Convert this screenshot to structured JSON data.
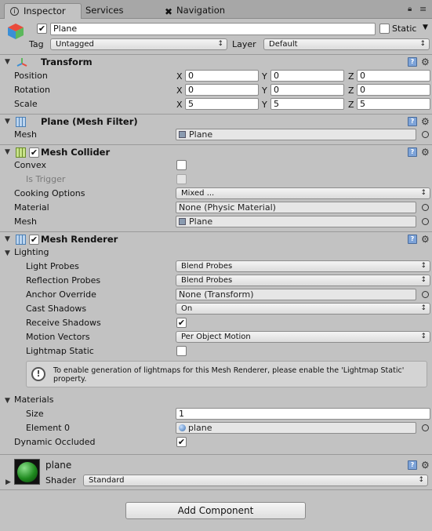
{
  "tabs": {
    "inspector": "Inspector",
    "services": "Services",
    "navigation": "Navigation"
  },
  "object": {
    "name": "Plane",
    "static_label": "Static",
    "tag_label": "Tag",
    "tag_value": "Untagged",
    "layer_label": "Layer",
    "layer_value": "Default"
  },
  "transform": {
    "title": "Transform",
    "position_label": "Position",
    "rotation_label": "Rotation",
    "scale_label": "Scale",
    "x": "X",
    "y": "Y",
    "z": "Z",
    "position": [
      "0",
      "0",
      "0"
    ],
    "rotation": [
      "0",
      "0",
      "0"
    ],
    "scale": [
      "5",
      "5",
      "5"
    ]
  },
  "mesh_filter": {
    "title": "Plane (Mesh Filter)",
    "mesh_label": "Mesh",
    "mesh_value": "Plane"
  },
  "mesh_collider": {
    "title": "Mesh Collider",
    "convex_label": "Convex",
    "is_trigger_label": "Is Trigger",
    "cooking_label": "Cooking Options",
    "cooking_value": "Mixed ...",
    "material_label": "Material",
    "material_value": "None (Physic Material)",
    "mesh_label": "Mesh",
    "mesh_value": "Plane"
  },
  "mesh_renderer": {
    "title": "Mesh Renderer",
    "lighting_label": "Lighting",
    "light_probes_label": "Light Probes",
    "light_probes_value": "Blend Probes",
    "reflection_probes_label": "Reflection Probes",
    "reflection_probes_value": "Blend Probes",
    "anchor_label": "Anchor Override",
    "anchor_value": "None (Transform)",
    "cast_shadows_label": "Cast Shadows",
    "cast_shadows_value": "On",
    "receive_shadows_label": "Receive Shadows",
    "motion_vectors_label": "Motion Vectors",
    "motion_vectors_value": "Per Object Motion",
    "lightmap_static_label": "Lightmap Static",
    "help_text": "To enable generation of lightmaps for this Mesh Renderer, please enable the 'Lightmap Static' property.",
    "materials_label": "Materials",
    "size_label": "Size",
    "size_value": "1",
    "element0_label": "Element 0",
    "element0_value": "plane",
    "dynamic_occluded_label": "Dynamic Occluded"
  },
  "material": {
    "name": "plane",
    "shader_label": "Shader",
    "shader_value": "Standard"
  },
  "add_component": "Add Component",
  "colors": {
    "accent_blue": "#7da3d8",
    "panel_bg": "#c2c2c2",
    "tab_bg": "#a7a7a7"
  }
}
